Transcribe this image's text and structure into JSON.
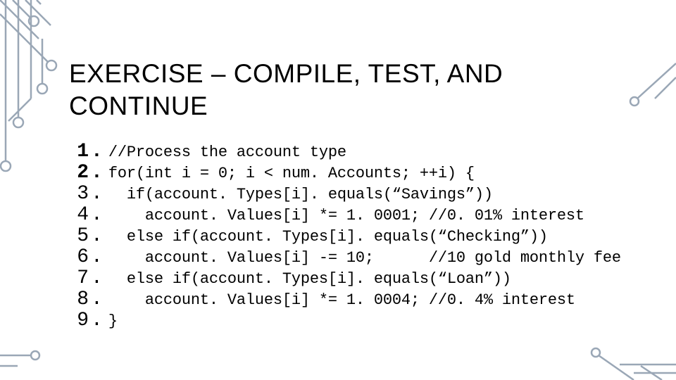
{
  "title": "EXERCISE – COMPILE, TEST, AND CONTINUE",
  "lines": [
    {
      "num": "1",
      "bold": true,
      "code": "//Process the account type"
    },
    {
      "num": "2",
      "bold": true,
      "code": "for(int i = 0; i < num. Accounts; ++i) {"
    },
    {
      "num": "3",
      "bold": false,
      "code": "  if(account. Types[i]. equals(“Savings”))"
    },
    {
      "num": "4",
      "bold": false,
      "code": "    account. Values[i] *= 1. 0001; //0. 01% interest"
    },
    {
      "num": "5",
      "bold": false,
      "code": "  else if(account. Types[i]. equals(“Checking”))"
    },
    {
      "num": "6",
      "bold": false,
      "code": "    account. Values[i] -= 10;      //10 gold monthly fee"
    },
    {
      "num": "7",
      "bold": false,
      "code": "  else if(account. Types[i]. equals(“Loan”))"
    },
    {
      "num": "8",
      "bold": false,
      "code": "    account. Values[i] *= 1. 0004; //0. 4% interest"
    },
    {
      "num": "9",
      "bold": false,
      "code": "}"
    }
  ]
}
